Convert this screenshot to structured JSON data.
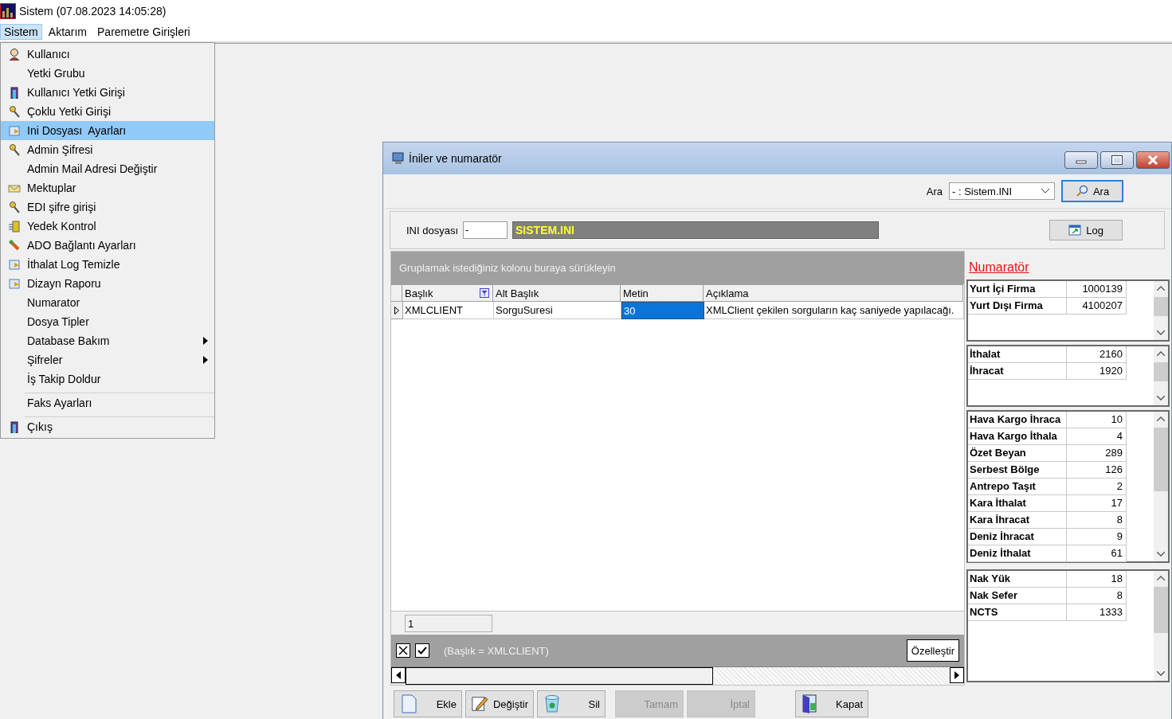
{
  "window": {
    "title": "Sistem (07.08.2023 14:05:28)"
  },
  "menu_bar": [
    {
      "label": "Sistem",
      "selected": true
    },
    {
      "label": "Aktarım",
      "selected": false
    },
    {
      "label": "Paremetre Girişleri",
      "selected": false
    }
  ],
  "dropdown": {
    "items": [
      {
        "label": "Kullanıcı",
        "selected": false,
        "submenu": false,
        "separator_before": false
      },
      {
        "label": "Yetki Grubu",
        "selected": false,
        "submenu": false,
        "separator_before": false
      },
      {
        "label": "Kullanıcı Yetki Girişi",
        "selected": false,
        "submenu": false,
        "separator_before": false
      },
      {
        "label": "Çoklu Yetki Girişi",
        "selected": false,
        "submenu": false,
        "separator_before": false
      },
      {
        "label": "Ini Dosyası  Ayarları",
        "selected": true,
        "submenu": false,
        "separator_before": false
      },
      {
        "label": "Admin Şifresi",
        "selected": false,
        "submenu": false,
        "separator_before": false
      },
      {
        "label": "Admin Mail Adresi Değiştir",
        "selected": false,
        "submenu": false,
        "separator_before": false
      },
      {
        "label": "Mektuplar",
        "selected": false,
        "submenu": false,
        "separator_before": false
      },
      {
        "label": "EDI şifre girişi",
        "selected": false,
        "submenu": false,
        "separator_before": false
      },
      {
        "label": "Yedek Kontrol",
        "selected": false,
        "submenu": false,
        "separator_before": false
      },
      {
        "label": "ADO Bağlantı Ayarları",
        "selected": false,
        "submenu": false,
        "separator_before": false
      },
      {
        "label": "İthalat Log Temizle",
        "selected": false,
        "submenu": false,
        "separator_before": false
      },
      {
        "label": "Dizayn Raporu",
        "selected": false,
        "submenu": false,
        "separator_before": false
      },
      {
        "label": "Numarator",
        "selected": false,
        "submenu": false,
        "separator_before": false
      },
      {
        "label": "Dosya Tipler",
        "selected": false,
        "submenu": false,
        "separator_before": false
      },
      {
        "label": "Database Bakım",
        "selected": false,
        "submenu": true,
        "separator_before": false
      },
      {
        "label": "Şifreler",
        "selected": false,
        "submenu": true,
        "separator_before": false
      },
      {
        "label": "İş Takip Doldur",
        "selected": false,
        "submenu": false,
        "separator_before": false
      },
      {
        "label": "Faks Ayarları",
        "selected": false,
        "submenu": false,
        "separator_before": true
      },
      {
        "label": "Çıkış",
        "selected": false,
        "submenu": false,
        "separator_before": true
      }
    ]
  },
  "dialog": {
    "title": "İniler ve numaratör",
    "search": {
      "label": "Ara",
      "value": "- : Sistem.INI",
      "button": "Ara"
    },
    "ini": {
      "label": "INI dosyası",
      "code": "-",
      "name": "SISTEM.INI",
      "log_button": "Log"
    },
    "grid": {
      "group_hint": "Gruplamak istediğiniz kolonu buraya sürükleyin",
      "columns": [
        {
          "label": "Başlık",
          "filtered": true
        },
        {
          "label": "Alt Başlık",
          "filtered": false
        },
        {
          "label": "Metin",
          "filtered": false
        },
        {
          "label": "Açıklama",
          "filtered": false
        }
      ],
      "rows": [
        {
          "current": true,
          "cells": [
            {
              "text": "XMLCLIENT",
              "selected": false
            },
            {
              "text": "SorguSuresi",
              "selected": false
            },
            {
              "text": "30",
              "selected": true
            },
            {
              "text": "XMLClient çekilen sorguların kaç saniyede yapılacağı.",
              "selected": false
            }
          ]
        }
      ],
      "footer_value": "1",
      "filter": {
        "enabled": true,
        "text": "(Başlık = XMLCLIENT)",
        "button": "Özelleştir"
      }
    },
    "numarator": {
      "title": "Numaratör",
      "groups": [
        [
          {
            "name": "Yurt İçi Firma",
            "value": "1000139"
          },
          {
            "name": "Yurt Dışı Firma",
            "value": "4100207"
          }
        ],
        [
          {
            "name": "İthalat",
            "value": "2160"
          },
          {
            "name": "İhracat",
            "value": "1920"
          }
        ],
        [
          {
            "name": "Hava Kargo İhraca",
            "value": "10"
          },
          {
            "name": "Hava Kargo İthala",
            "value": "4"
          },
          {
            "name": "Özet Beyan",
            "value": "289"
          },
          {
            "name": "Serbest Bölge",
            "value": "126"
          },
          {
            "name": "Antrepo Taşıt",
            "value": "2"
          },
          {
            "name": "Kara İthalat",
            "value": "17"
          },
          {
            "name": "Kara İhracat",
            "value": "8"
          },
          {
            "name": "Deniz İhracat",
            "value": "9"
          },
          {
            "name": "Deniz İthalat",
            "value": "61"
          }
        ],
        [
          {
            "name": "Nak Yük",
            "value": "18"
          },
          {
            "name": "Nak Sefer",
            "value": "8"
          },
          {
            "name": "NCTS",
            "value": "1333"
          }
        ]
      ]
    },
    "buttons": [
      {
        "label": "Ekle",
        "disabled": false
      },
      {
        "label": "Değiştir",
        "disabled": false
      },
      {
        "label": "Sil",
        "disabled": false
      },
      {
        "label": "Tamam",
        "disabled": true
      },
      {
        "label": "İptal",
        "disabled": true
      },
      {
        "label": "Kapat",
        "disabled": false
      }
    ]
  }
}
